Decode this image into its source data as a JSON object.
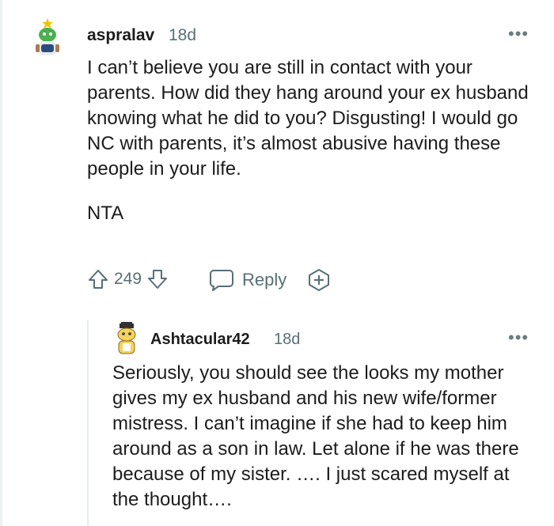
{
  "comments": [
    {
      "author": "aspralav",
      "age": "18d",
      "avatar": "snoo-avatar-icon",
      "body_paragraphs": [
        "I can’t believe you are still in contact with your parents. How did they hang around your ex husband knowing what he did to you? Disgusting! I would go NC with parents, it’s almost abusive having these people in your life.",
        "NTA"
      ],
      "votes": "249",
      "reply_label": "Reply"
    },
    {
      "author": "Ashtacular42",
      "age": "18d",
      "avatar": "snoo-avatar-icon",
      "body_paragraphs": [
        "Seriously, you should see the looks my mother gives my ex husband and his new wife/former mistress. I can’t imagine if she had to keep him around as a son in law. Let alone if he was there because of my sister. …. I just scared myself at the thought…."
      ]
    }
  ],
  "icons": {
    "more": "more-options-icon",
    "upvote": "upvote-arrow-icon",
    "downvote": "downvote-arrow-icon",
    "reply": "speech-bubble-icon",
    "award": "award-plus-icon"
  },
  "colors": {
    "text": "#1c1c1c",
    "meta": "#576f76",
    "thread_line": "#e5ebee"
  }
}
